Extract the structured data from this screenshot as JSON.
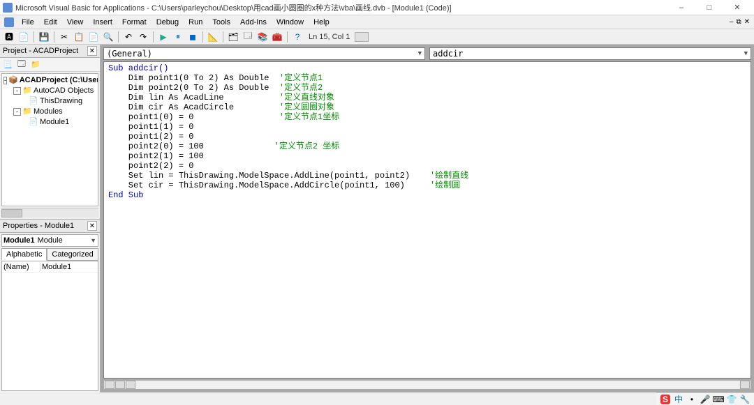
{
  "window": {
    "title": "Microsoft Visual Basic for Applications - C:\\Users\\parleychou\\Desktop\\用cad画小圆圈的x种方法\\vba\\画线.dvb - [Module1 (Code)]"
  },
  "menu": {
    "file": "File",
    "edit": "Edit",
    "view": "View",
    "insert": "Insert",
    "format": "Format",
    "debug": "Debug",
    "run": "Run",
    "tools": "Tools",
    "addins": "Add-Ins",
    "window": "Window",
    "help": "Help"
  },
  "toolbar": {
    "status": "Ln 15, Col 1"
  },
  "project_panel": {
    "title": "Project - ACADProject",
    "root": "ACADProject (C:\\User",
    "autocad_objects": "AutoCAD Objects",
    "thisdrawing": "ThisDrawing",
    "modules": "Modules",
    "module1": "Module1"
  },
  "properties_panel": {
    "title": "Properties - Module1",
    "combo_bold": "Module1",
    "combo_text": "Module",
    "tab_alpha": "Alphabetic",
    "tab_cat": "Categorized",
    "name_key": "(Name)",
    "name_val": "Module1"
  },
  "editor": {
    "combo_left": "(General)",
    "combo_right": "addcir"
  },
  "code": {
    "l1a": "Sub addcir()",
    "l2a": "    Dim point1(0 To 2) As Double  ",
    "l2b": "'定义节点1",
    "l3a": "    Dim point2(0 To 2) As Double  ",
    "l3b": "'定义节点2",
    "l4a": "    Dim lin As AcadLine           ",
    "l4b": "'定义直线对象",
    "l5a": "    Dim cir As AcadCircle         ",
    "l5b": "'定义圆圈对象",
    "l6a": "    point1(0) = 0                 ",
    "l6b": "'定义节点1坐标",
    "l7a": "    point1(1) = 0",
    "l8a": "    point1(2) = 0",
    "l9a": "    point2(0) = 100              ",
    "l9b": "'定义节点2 坐标",
    "l10a": "    point2(1) = 100",
    "l11a": "    point2(2) = 0",
    "l12a": "    Set lin = ThisDrawing.ModelSpace.AddLine(point1, point2)    ",
    "l12b": "'绘制直线",
    "l13a": "    Set cir = ThisDrawing.ModelSpace.AddCircle(point1, 100)     ",
    "l13b": "'绘制圆",
    "l14a": "End Sub"
  },
  "systray": {
    "s_badge": "S",
    "lang": "中"
  }
}
